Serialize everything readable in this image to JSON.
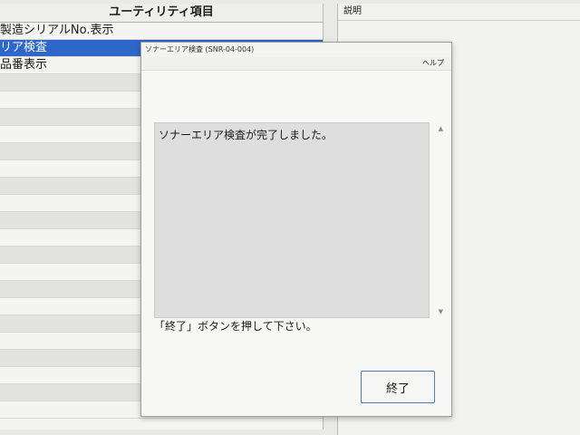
{
  "utility_panel": {
    "header": "ユーティリティ項目",
    "items": [
      {
        "label": "製造シリアルNo.表示",
        "selected": false
      },
      {
        "label": "リア検査",
        "selected": true
      },
      {
        "label": "品番表示",
        "selected": false
      },
      {
        "label": ""
      },
      {
        "label": ""
      },
      {
        "label": ""
      },
      {
        "label": ""
      },
      {
        "label": ""
      },
      {
        "label": ""
      },
      {
        "label": ""
      },
      {
        "label": ""
      },
      {
        "label": ""
      },
      {
        "label": ""
      },
      {
        "label": ""
      },
      {
        "label": ""
      },
      {
        "label": ""
      },
      {
        "label": ""
      },
      {
        "label": ""
      },
      {
        "label": ""
      },
      {
        "label": ""
      },
      {
        "label": ""
      },
      {
        "label": ""
      },
      {
        "label": ""
      }
    ]
  },
  "description_panel": {
    "title": "説明"
  },
  "dialog": {
    "title": "ソナーエリア検査 (SNR-04-004)",
    "menu_help": "ヘルプ",
    "message": "ソナーエリア検査が完了しました。",
    "instruction": "「終了」ボタンを押して下さい。",
    "end_button": "終了",
    "scroll_up_icon": "triangle-up-icon",
    "scroll_down_icon": "triangle-down-icon"
  },
  "colors": {
    "selected_row": "#2f66c9",
    "button_border": "#4a7ac0"
  }
}
